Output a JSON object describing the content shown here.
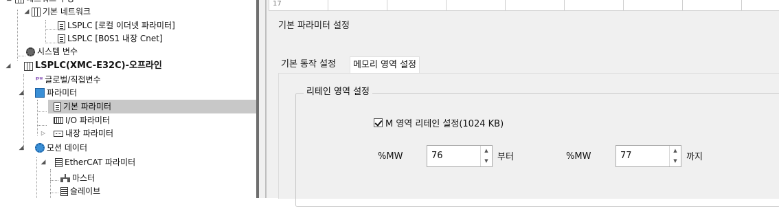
{
  "tree": {
    "nodes": [
      {
        "label": "네트워크 구성"
      },
      {
        "label": "기본 네트워크"
      },
      {
        "label": "LSPLC [로컬 이더넷 파라미터]"
      },
      {
        "label": "LSPLC [B0S1 내장 Cnet]"
      },
      {
        "label": "시스템 변수"
      },
      {
        "label": "LSPLC(XMC-E32C)-오프라인"
      },
      {
        "label": "글로벌/직접변수"
      },
      {
        "label": "파라미터"
      },
      {
        "label": "기본 파라미터"
      },
      {
        "label": "I/O 파라미터"
      },
      {
        "label": "내장 파라미터"
      },
      {
        "label": "모션 데이터"
      },
      {
        "label": "EtherCAT 파라미터"
      },
      {
        "label": "마스터"
      },
      {
        "label": "슬레이브"
      }
    ]
  },
  "grid": {
    "row_header": "17"
  },
  "dialog": {
    "title": "기본 파라미터 설정",
    "tabs": [
      "기본 동작 설정",
      "메모리 영역 설정"
    ],
    "active_tab": "메모리 영역 설정",
    "group": {
      "legend": "리테인 영역 설정",
      "checkbox_label": "M 영역 리테인 설정(1024 KB)",
      "checked": true,
      "from_prefix": "%MW",
      "from_value": "76",
      "from_suffix": "부터",
      "to_prefix": "%MW",
      "to_value": "77",
      "to_suffix": "까지"
    }
  },
  "colors": {
    "selection": "#c8c8c8",
    "panel": "#f0f0f0",
    "accent": "#3a8fd6"
  }
}
